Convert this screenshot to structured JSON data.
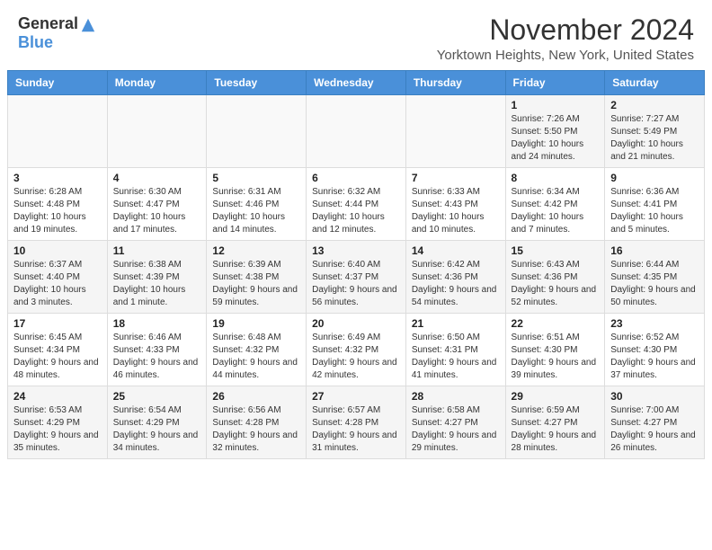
{
  "header": {
    "logo_general": "General",
    "logo_blue": "Blue",
    "month_title": "November 2024",
    "location": "Yorktown Heights, New York, United States"
  },
  "weekdays": [
    "Sunday",
    "Monday",
    "Tuesday",
    "Wednesday",
    "Thursday",
    "Friday",
    "Saturday"
  ],
  "weeks": [
    [
      {
        "day": "",
        "info": ""
      },
      {
        "day": "",
        "info": ""
      },
      {
        "day": "",
        "info": ""
      },
      {
        "day": "",
        "info": ""
      },
      {
        "day": "",
        "info": ""
      },
      {
        "day": "1",
        "info": "Sunrise: 7:26 AM\nSunset: 5:50 PM\nDaylight: 10 hours and 24 minutes."
      },
      {
        "day": "2",
        "info": "Sunrise: 7:27 AM\nSunset: 5:49 PM\nDaylight: 10 hours and 21 minutes."
      }
    ],
    [
      {
        "day": "3",
        "info": "Sunrise: 6:28 AM\nSunset: 4:48 PM\nDaylight: 10 hours and 19 minutes."
      },
      {
        "day": "4",
        "info": "Sunrise: 6:30 AM\nSunset: 4:47 PM\nDaylight: 10 hours and 17 minutes."
      },
      {
        "day": "5",
        "info": "Sunrise: 6:31 AM\nSunset: 4:46 PM\nDaylight: 10 hours and 14 minutes."
      },
      {
        "day": "6",
        "info": "Sunrise: 6:32 AM\nSunset: 4:44 PM\nDaylight: 10 hours and 12 minutes."
      },
      {
        "day": "7",
        "info": "Sunrise: 6:33 AM\nSunset: 4:43 PM\nDaylight: 10 hours and 10 minutes."
      },
      {
        "day": "8",
        "info": "Sunrise: 6:34 AM\nSunset: 4:42 PM\nDaylight: 10 hours and 7 minutes."
      },
      {
        "day": "9",
        "info": "Sunrise: 6:36 AM\nSunset: 4:41 PM\nDaylight: 10 hours and 5 minutes."
      }
    ],
    [
      {
        "day": "10",
        "info": "Sunrise: 6:37 AM\nSunset: 4:40 PM\nDaylight: 10 hours and 3 minutes."
      },
      {
        "day": "11",
        "info": "Sunrise: 6:38 AM\nSunset: 4:39 PM\nDaylight: 10 hours and 1 minute."
      },
      {
        "day": "12",
        "info": "Sunrise: 6:39 AM\nSunset: 4:38 PM\nDaylight: 9 hours and 59 minutes."
      },
      {
        "day": "13",
        "info": "Sunrise: 6:40 AM\nSunset: 4:37 PM\nDaylight: 9 hours and 56 minutes."
      },
      {
        "day": "14",
        "info": "Sunrise: 6:42 AM\nSunset: 4:36 PM\nDaylight: 9 hours and 54 minutes."
      },
      {
        "day": "15",
        "info": "Sunrise: 6:43 AM\nSunset: 4:36 PM\nDaylight: 9 hours and 52 minutes."
      },
      {
        "day": "16",
        "info": "Sunrise: 6:44 AM\nSunset: 4:35 PM\nDaylight: 9 hours and 50 minutes."
      }
    ],
    [
      {
        "day": "17",
        "info": "Sunrise: 6:45 AM\nSunset: 4:34 PM\nDaylight: 9 hours and 48 minutes."
      },
      {
        "day": "18",
        "info": "Sunrise: 6:46 AM\nSunset: 4:33 PM\nDaylight: 9 hours and 46 minutes."
      },
      {
        "day": "19",
        "info": "Sunrise: 6:48 AM\nSunset: 4:32 PM\nDaylight: 9 hours and 44 minutes."
      },
      {
        "day": "20",
        "info": "Sunrise: 6:49 AM\nSunset: 4:32 PM\nDaylight: 9 hours and 42 minutes."
      },
      {
        "day": "21",
        "info": "Sunrise: 6:50 AM\nSunset: 4:31 PM\nDaylight: 9 hours and 41 minutes."
      },
      {
        "day": "22",
        "info": "Sunrise: 6:51 AM\nSunset: 4:30 PM\nDaylight: 9 hours and 39 minutes."
      },
      {
        "day": "23",
        "info": "Sunrise: 6:52 AM\nSunset: 4:30 PM\nDaylight: 9 hours and 37 minutes."
      }
    ],
    [
      {
        "day": "24",
        "info": "Sunrise: 6:53 AM\nSunset: 4:29 PM\nDaylight: 9 hours and 35 minutes."
      },
      {
        "day": "25",
        "info": "Sunrise: 6:54 AM\nSunset: 4:29 PM\nDaylight: 9 hours and 34 minutes."
      },
      {
        "day": "26",
        "info": "Sunrise: 6:56 AM\nSunset: 4:28 PM\nDaylight: 9 hours and 32 minutes."
      },
      {
        "day": "27",
        "info": "Sunrise: 6:57 AM\nSunset: 4:28 PM\nDaylight: 9 hours and 31 minutes."
      },
      {
        "day": "28",
        "info": "Sunrise: 6:58 AM\nSunset: 4:27 PM\nDaylight: 9 hours and 29 minutes."
      },
      {
        "day": "29",
        "info": "Sunrise: 6:59 AM\nSunset: 4:27 PM\nDaylight: 9 hours and 28 minutes."
      },
      {
        "day": "30",
        "info": "Sunrise: 7:00 AM\nSunset: 4:27 PM\nDaylight: 9 hours and 26 minutes."
      }
    ]
  ]
}
